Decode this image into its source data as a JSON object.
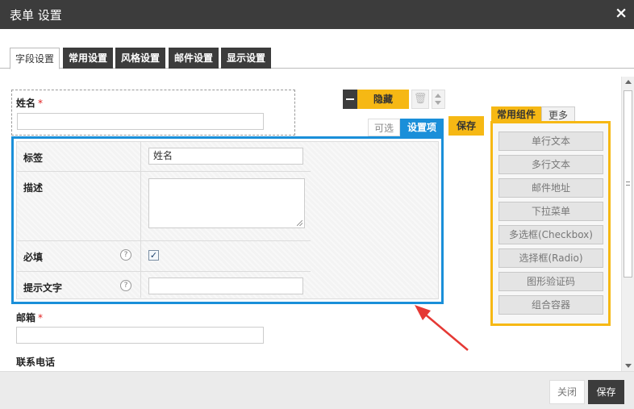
{
  "dialog": {
    "title": "表单 设置"
  },
  "tabs": [
    {
      "label": "字段设置"
    },
    {
      "label": "常用设置"
    },
    {
      "label": "风格设置"
    },
    {
      "label": "邮件设置"
    },
    {
      "label": "显示设置"
    }
  ],
  "fields": {
    "name": {
      "label": "姓名",
      "required_mark": "*"
    },
    "email": {
      "label": "邮箱",
      "required_mark": "*"
    },
    "phone": {
      "label": "联系电话"
    }
  },
  "field_toolbar": {
    "hide_label": "隐藏",
    "optional_tab": "可选",
    "settings_tab": "设置项",
    "save_label": "保存"
  },
  "settings": {
    "label_row": {
      "label": "标签",
      "value": "姓名"
    },
    "description_row": {
      "label": "描述",
      "value": ""
    },
    "required_row": {
      "label": "必填",
      "checked": true,
      "check_glyph": "✓",
      "help": "?"
    },
    "hint_row": {
      "label": "提示文字",
      "value": "",
      "help": "?"
    }
  },
  "components": {
    "tabs": [
      "常用组件",
      "更多"
    ],
    "items": [
      "单行文本",
      "多行文本",
      "邮件地址",
      "下拉菜单",
      "多选框(Checkbox)",
      "选择框(Radio)",
      "图形验证码",
      "组合容器"
    ]
  },
  "footer": {
    "close_label": "关闭",
    "save_label": "保存"
  },
  "colors": {
    "accent_blue": "#1a8fd9",
    "accent_yellow": "#f6b814",
    "dark": "#3c3c3c",
    "arrow_red": "#e53935"
  },
  "icons": {
    "close": "close-icon",
    "minus": "minus-icon",
    "trash": "trash-icon",
    "help": "help-icon",
    "check": "check-icon"
  }
}
